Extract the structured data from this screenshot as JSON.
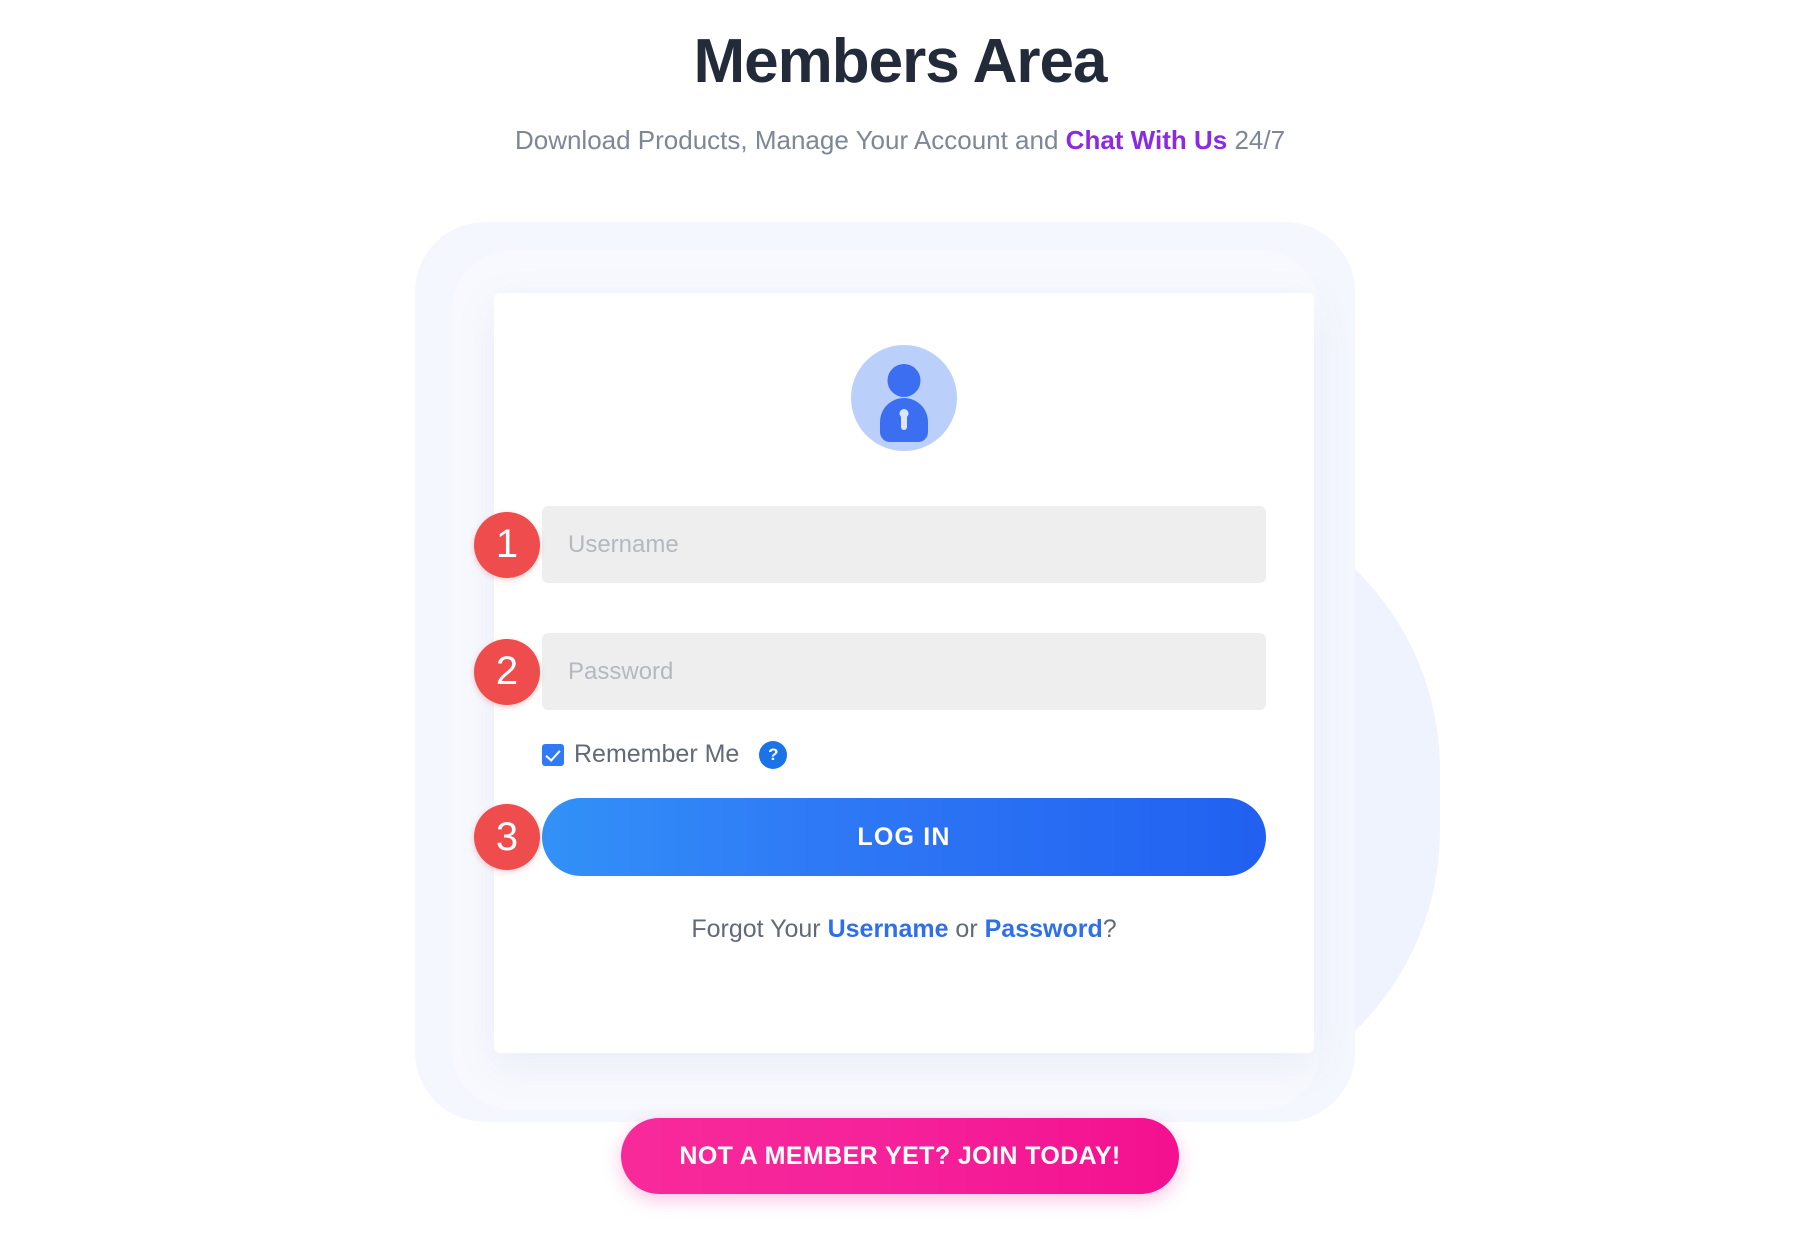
{
  "header": {
    "title": "Members Area",
    "subtitle_before": "Download Products, Manage Your Account and ",
    "subtitle_link": "Chat With Us",
    "subtitle_after": " 24/7"
  },
  "card": {
    "avatar_icon": "user-lock-avatar-icon",
    "fields": [
      {
        "badge": "1",
        "name": "username",
        "placeholder": "Username",
        "value": ""
      },
      {
        "badge": "2",
        "name": "password",
        "placeholder": "Password",
        "value": ""
      }
    ],
    "remember": {
      "label": "Remember Me",
      "checked": true,
      "help_icon": "?"
    },
    "login": {
      "badge": "3",
      "label": "LOG IN"
    },
    "forgot": {
      "prefix": "Forgot Your ",
      "username_link": "Username",
      "separator": " or ",
      "password_link": "Password",
      "suffix": "?"
    }
  },
  "join": {
    "label": "NOT A MEMBER YET? JOIN TODAY!"
  },
  "colors": {
    "title": "#232b3a",
    "subtitle": "#7e8795",
    "accent_purple": "#8a2be2",
    "badge_red": "#ef4d4d",
    "login_blue": "#2160f0",
    "join_pink": "#f4108f",
    "link_blue": "#2f6fe8",
    "input_bg": "#eeeeee",
    "avatar_bg": "#bacffa",
    "avatar_fg": "#3b6ef0"
  }
}
